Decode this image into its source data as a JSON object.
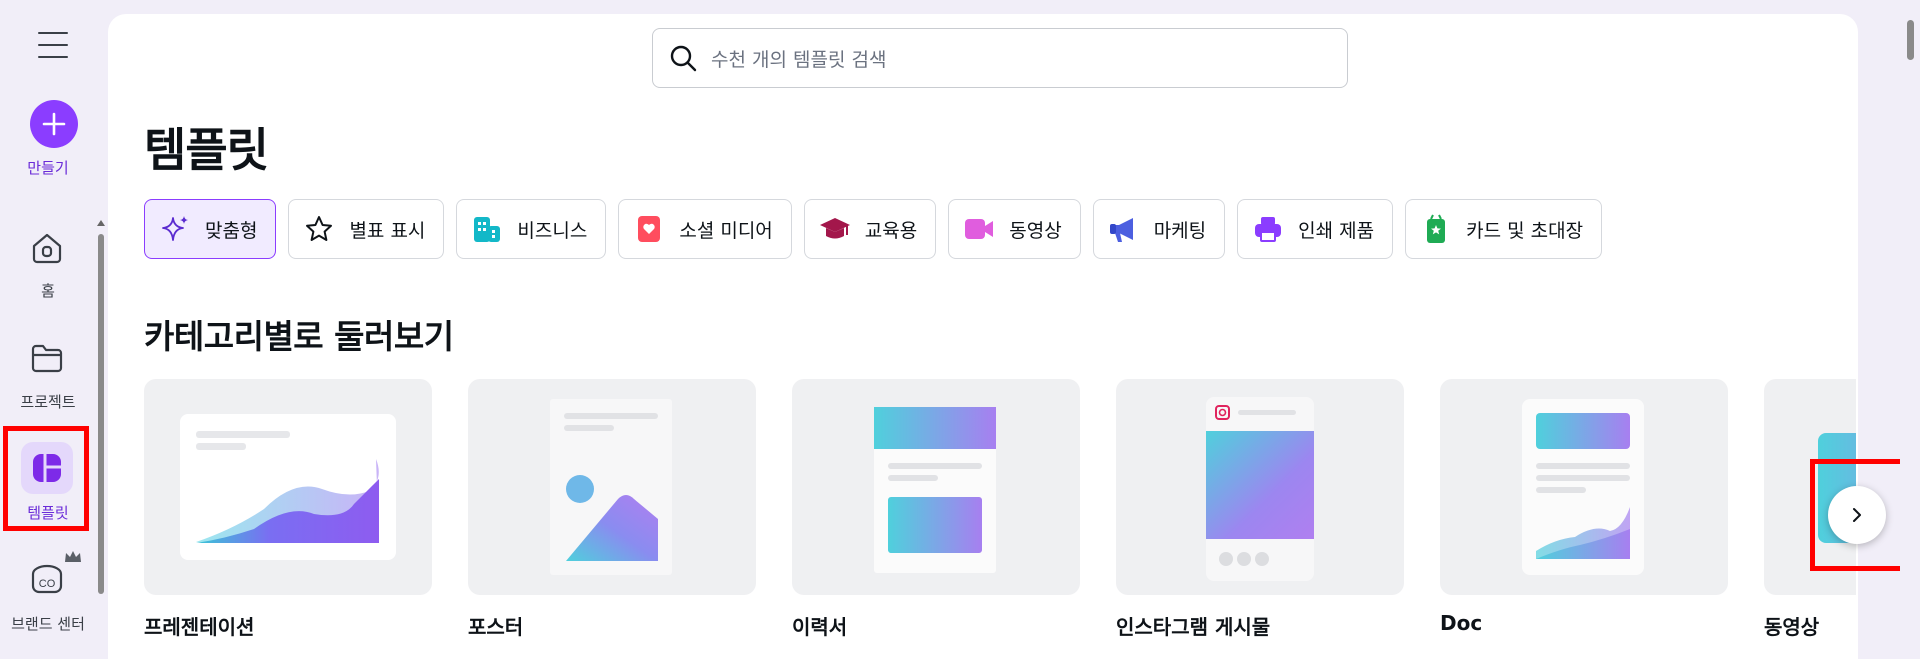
{
  "rail": {
    "create_label": "만들기",
    "items": [
      {
        "label": "홈",
        "icon": "home-icon"
      },
      {
        "label": "프로젝트",
        "icon": "folder-icon"
      },
      {
        "label": "템플릿",
        "icon": "templates-icon"
      },
      {
        "label": "브랜드 센터",
        "icon": "brand-icon"
      }
    ]
  },
  "search": {
    "placeholder": "수천 개의 템플릿 검색"
  },
  "page_title": "템플릿",
  "chips": [
    {
      "label": "맞춤형",
      "icon": "sparkle-icon"
    },
    {
      "label": "별표 표시",
      "icon": "star-icon"
    },
    {
      "label": "비즈니스",
      "icon": "building-icon"
    },
    {
      "label": "소셜 미디어",
      "icon": "heart-icon"
    },
    {
      "label": "교육용",
      "icon": "graduation-cap-icon"
    },
    {
      "label": "동영상",
      "icon": "video-camera-icon"
    },
    {
      "label": "마케팅",
      "icon": "megaphone-icon"
    },
    {
      "label": "인쇄 제품",
      "icon": "printer-icon"
    },
    {
      "label": "카드 및 초대장",
      "icon": "card-icon"
    }
  ],
  "section_title": "카테고리별로 둘러보기",
  "categories": [
    {
      "name": "프레젠테이션"
    },
    {
      "name": "포스터"
    },
    {
      "name": "이력서"
    },
    {
      "name": "인스타그램 게시물"
    },
    {
      "name": "Doc"
    },
    {
      "name": "동영상"
    }
  ],
  "colors": {
    "accent": "#8b3dff",
    "highlight_box": "#ff0000"
  }
}
